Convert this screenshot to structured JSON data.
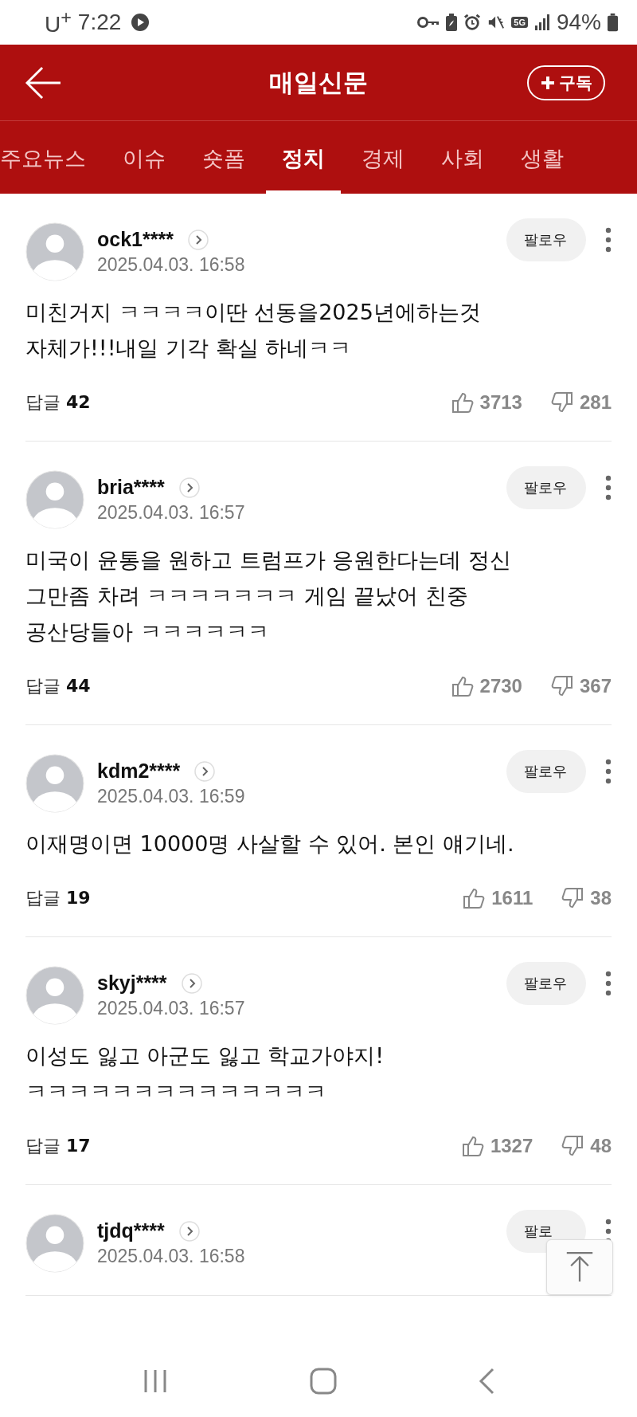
{
  "status_bar": {
    "carrier": "U$^{+}$",
    "time": "7:22",
    "network": "5G",
    "battery": "94%"
  },
  "header": {
    "title": "매일신문",
    "subscribe_label": "구독"
  },
  "tabs": [
    {
      "label": "주요뉴스",
      "selected": false
    },
    {
      "label": "이슈",
      "selected": false
    },
    {
      "label": "숏폼",
      "selected": false
    },
    {
      "label": "정치",
      "selected": true
    },
    {
      "label": "경제",
      "selected": false
    },
    {
      "label": "사회",
      "selected": false
    },
    {
      "label": "생활",
      "selected": false
    }
  ],
  "comments": [
    {
      "user": "ock1****",
      "date": "2025.04.03. 16:58",
      "follow": "팔로우",
      "text": [
        "미친거지 ㅋㅋㅋㅋ이딴 선동을2025년에하는것",
        "자체가!!!내일 기각 확실 하네ㅋㅋ"
      ],
      "reply_label": "답글",
      "replies": "42",
      "likes": "3713",
      "dislikes": "281"
    },
    {
      "user": "bria****",
      "date": "2025.04.03. 16:57",
      "follow": "팔로우",
      "text": [
        "미국이 윤통을 원하고 트럼프가 응원한다는데 정신",
        "그만좀 차려 ㅋㅋㅋㅋㅋㅋㅋ 게임 끝났어 친중",
        "공산당들아 ㅋㅋㅋㅋㅋㅋ"
      ],
      "reply_label": "답글",
      "replies": "44",
      "likes": "2730",
      "dislikes": "367"
    },
    {
      "user": "kdm2****",
      "date": "2025.04.03. 16:59",
      "follow": "팔로우",
      "text": [
        "이재명이면 10000명 사살할 수 있어. 본인 얘기네."
      ],
      "reply_label": "답글",
      "replies": "19",
      "likes": "1611",
      "dislikes": "38"
    },
    {
      "user": "skyj****",
      "date": "2025.04.03. 16:57",
      "follow": "팔로우",
      "text": [
        "이성도 잃고 아군도 잃고 학교가야지!",
        "ㅋㅋㅋㅋㅋㅋㅋㅋㅋㅋㅋㅋㅋㅋ"
      ],
      "reply_label": "답글",
      "replies": "17",
      "likes": "1327",
      "dislikes": "48"
    },
    {
      "user": "tjdq****",
      "date": "2025.04.03. 16:58",
      "follow": "팔로"
    }
  ]
}
